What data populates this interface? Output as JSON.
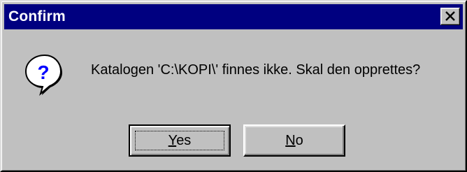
{
  "window": {
    "title": "Confirm",
    "close_icon": "close-x-icon"
  },
  "message": {
    "icon": "question-icon",
    "text": "Katalogen 'C:\\KOPI\\' finnes ikke. Skal den opprettes?"
  },
  "buttons": {
    "yes_label": "Yes",
    "no_label": "No"
  },
  "colors": {
    "titlebar": "#000080",
    "face": "#c0c0c0"
  }
}
